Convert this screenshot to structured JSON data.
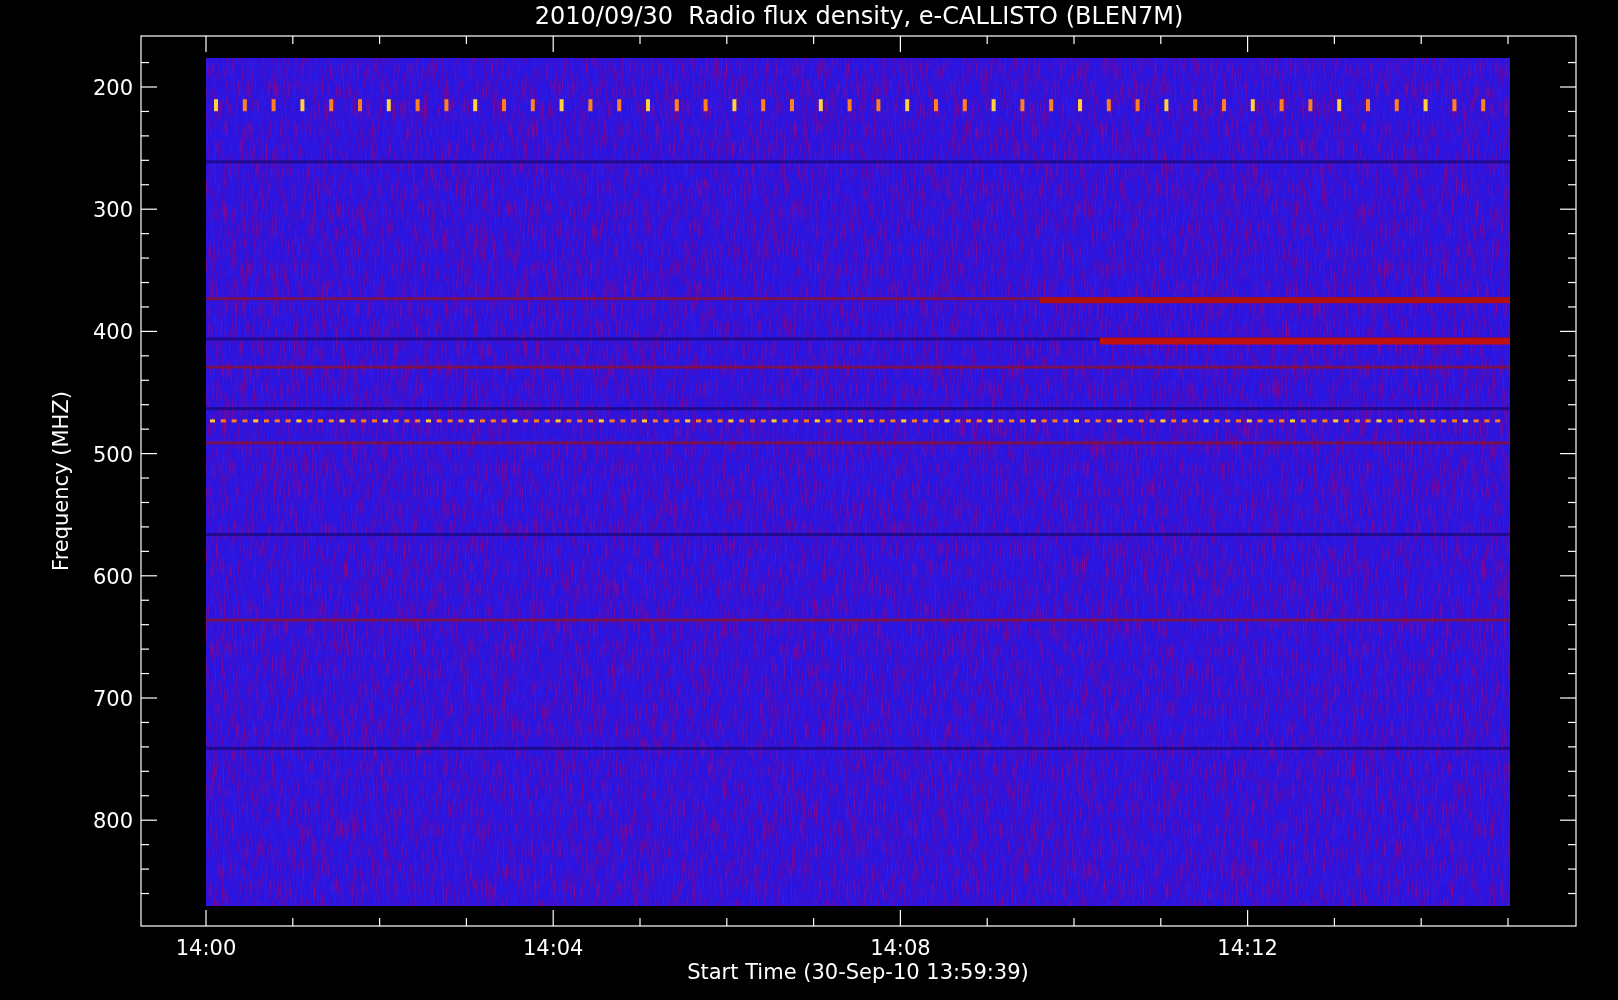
{
  "title": "2010/09/30  Radio flux density, e-CALLISTO (BLEN7M)",
  "y_axis": {
    "label": "Frequency (MHZ)",
    "ticks": [
      "200",
      "300",
      "400",
      "500",
      "600",
      "700",
      "800"
    ]
  },
  "x_axis": {
    "label": "Start Time (30-Sep-10 13:59:39)",
    "ticks": [
      "14:00",
      "14:04",
      "14:08",
      "14:12"
    ]
  }
}
